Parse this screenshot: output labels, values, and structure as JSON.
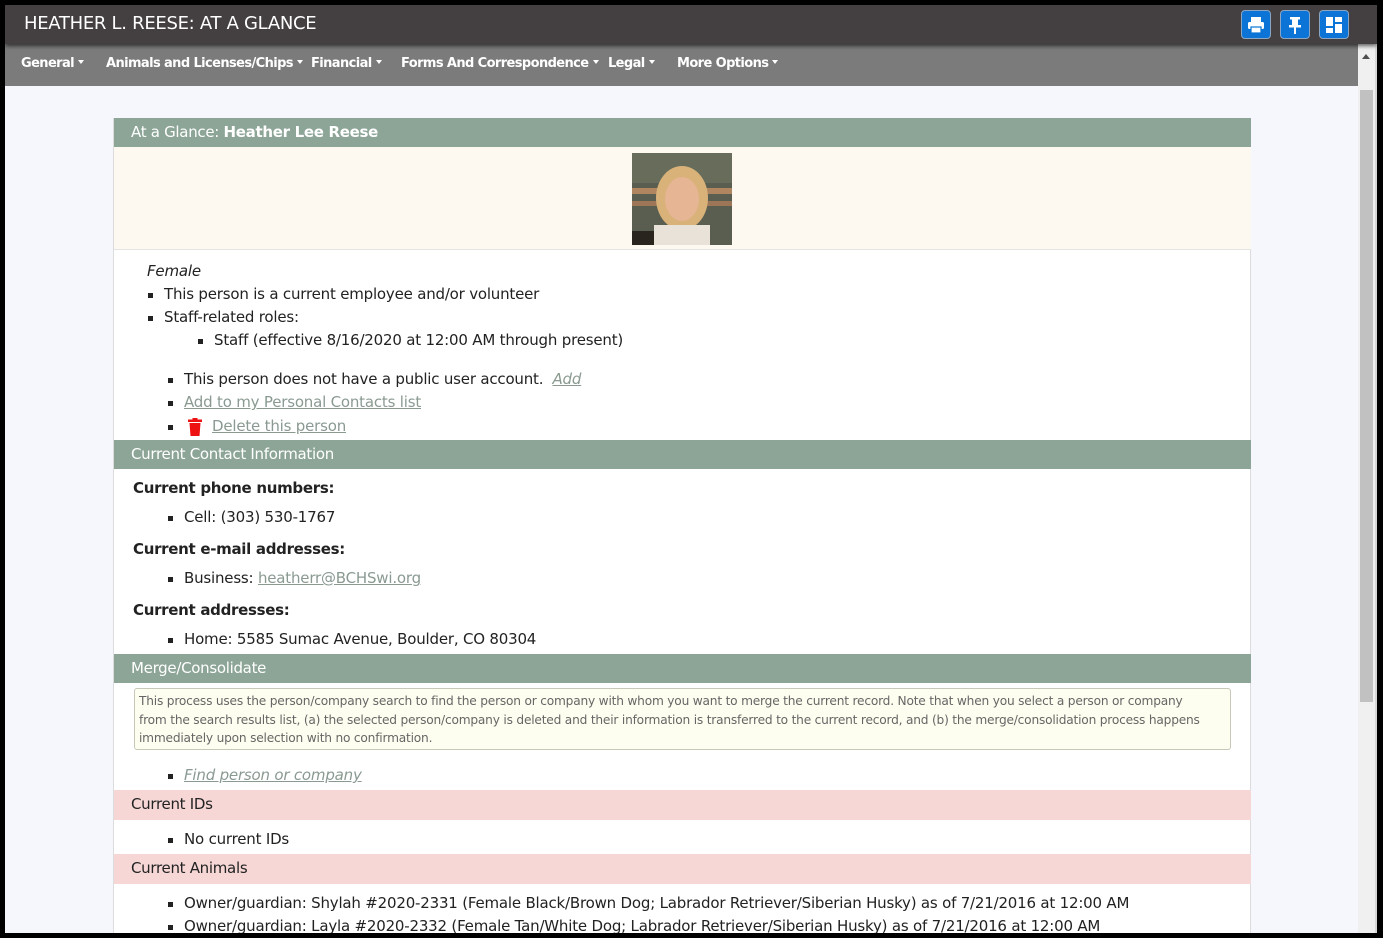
{
  "window": {
    "title": "HEATHER L. REESE: AT A GLANCE",
    "buttons": [
      {
        "name": "print",
        "icon": "printer-icon"
      },
      {
        "name": "pin",
        "icon": "pushpin-icon"
      },
      {
        "name": "layout",
        "icon": "dashboard-layout-icon"
      }
    ]
  },
  "menu": {
    "items": [
      {
        "label": "General"
      },
      {
        "label": "Animals and Licenses/Chips"
      },
      {
        "label": "Financial"
      },
      {
        "label": "Forms And Correspondence"
      },
      {
        "label": "Legal"
      },
      {
        "label": "More Options"
      }
    ]
  },
  "glance": {
    "header_prefix": "At a Glance: ",
    "header_name": "Heather Lee Reese",
    "photo_alt": "Photo of Heather Lee Reese",
    "gender": "Female",
    "employee_status": "This person is a current employee and/or volunteer",
    "staff_roles_label": "Staff-related roles:",
    "staff_roles": [
      "Staff (effective 8/16/2020 at 12:00 AM through present)"
    ],
    "public_account_text": "This person does not have a public user account.",
    "public_account_add_link": "Add",
    "add_contacts_link": "Add to my Personal Contacts list",
    "delete_link": "Delete this person",
    "delete_icon_color": "#ee1111"
  },
  "contact": {
    "header": "Current Contact Information",
    "phone_label": "Current phone numbers:",
    "phones": [
      "Cell: (303) 530-1767"
    ],
    "email_label": "Current e-mail addresses:",
    "email_prefix": "Business: ",
    "email": "heatherr@BCHSwi.org",
    "address_label": "Current addresses:",
    "addresses": [
      "Home: 5585 Sumac Avenue, Boulder, CO 80304"
    ]
  },
  "merge": {
    "header": "Merge/Consolidate",
    "notice_lines": [
      "This process uses the person/company search to find the person or company with whom you want to merge the current record. Note that when you select a person or company",
      "from the search results list, (a) the selected person/company is deleted and their information is transferred to the current record, and (b) the merge/consolidation process happens",
      "immediately upon selection with no confirmation."
    ],
    "find_link": "Find person or company"
  },
  "ids": {
    "header": "Current IDs",
    "items": [
      "No current IDs"
    ]
  },
  "animals": {
    "header": "Current Animals",
    "items": [
      "Owner/guardian: Shylah #2020-2331 (Female Black/Brown Dog; Labrador Retriever/Siberian Husky) as of 7/21/2016 at 12:00 AM",
      "Owner/guardian: Layla #2020-2332 (Female Tan/White Dog; Labrador Retriever/Siberian Husky) as of 7/21/2016 at 12:00 AM"
    ]
  },
  "colors": {
    "titlebar": "#443f40",
    "menubar": "#7b7b7b",
    "section_green": "#8ca597",
    "section_pink": "#f6d7d6",
    "button_blue": "#0b74d6",
    "link": "#8a9a91"
  }
}
